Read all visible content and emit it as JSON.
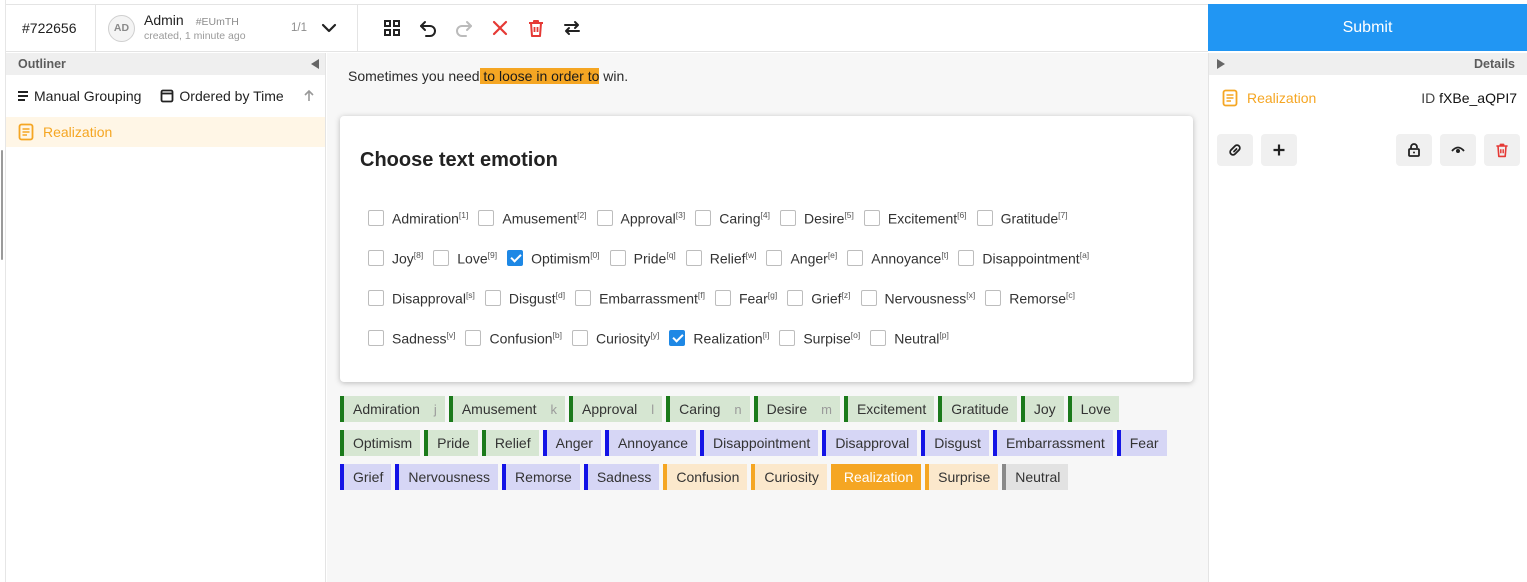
{
  "task": {
    "id": "#722656"
  },
  "annotation": {
    "avatar_initials": "AD",
    "user": "Admin",
    "tag": "#EUmTH",
    "meta": "created, 1 minute ago",
    "count": "1/1"
  },
  "toolbar": {
    "icons": [
      "grid-icon",
      "undo-icon",
      "redo-icon",
      "close-icon",
      "trash-icon",
      "swap-icon"
    ],
    "submit_label": "Submit"
  },
  "outliner": {
    "title": "Outliner",
    "grouping_label": "Manual Grouping",
    "ordering_label": "Ordered by Time",
    "regions": [
      {
        "label": "Realization"
      }
    ]
  },
  "text": {
    "before": "Sometimes you need",
    "highlight": " to loose in order to",
    "after": " win."
  },
  "choices": {
    "title": "Choose text emotion",
    "rows": [
      [
        {
          "label": "Admiration",
          "hotkey": "[1]",
          "checked": false
        },
        {
          "label": "Amusement",
          "hotkey": "[2]",
          "checked": false
        },
        {
          "label": "Approval",
          "hotkey": "[3]",
          "checked": false
        },
        {
          "label": "Caring",
          "hotkey": "[4]",
          "checked": false
        },
        {
          "label": "Desire",
          "hotkey": "[5]",
          "checked": false
        },
        {
          "label": "Excitement",
          "hotkey": "[6]",
          "checked": false
        },
        {
          "label": "Gratitude",
          "hotkey": "[7]",
          "checked": false
        }
      ],
      [
        {
          "label": "Joy",
          "hotkey": "[8]",
          "checked": false
        },
        {
          "label": "Love",
          "hotkey": "[9]",
          "checked": false
        },
        {
          "label": "Optimism",
          "hotkey": "[0]",
          "checked": true
        },
        {
          "label": "Pride",
          "hotkey": "[q]",
          "checked": false
        },
        {
          "label": "Relief",
          "hotkey": "[w]",
          "checked": false
        },
        {
          "label": "Anger",
          "hotkey": "[e]",
          "checked": false
        },
        {
          "label": "Annoyance",
          "hotkey": "[t]",
          "checked": false
        },
        {
          "label": "Disappointment",
          "hotkey": "[a]",
          "checked": false
        }
      ],
      [
        {
          "label": "Disapproval",
          "hotkey": "[s]",
          "checked": false
        },
        {
          "label": "Disgust",
          "hotkey": "[d]",
          "checked": false
        },
        {
          "label": "Embarrassment",
          "hotkey": "[f]",
          "checked": false
        },
        {
          "label": "Fear",
          "hotkey": "[g]",
          "checked": false
        },
        {
          "label": "Grief",
          "hotkey": "[z]",
          "checked": false
        },
        {
          "label": "Nervousness",
          "hotkey": "[x]",
          "checked": false
        },
        {
          "label": "Remorse",
          "hotkey": "[c]",
          "checked": false
        }
      ],
      [
        {
          "label": "Sadness",
          "hotkey": "[v]",
          "checked": false
        },
        {
          "label": "Confusion",
          "hotkey": "[b]",
          "checked": false
        },
        {
          "label": "Curiosity",
          "hotkey": "[y]",
          "checked": false
        },
        {
          "label": "Realization",
          "hotkey": "[i]",
          "checked": true
        },
        {
          "label": "Surpise",
          "hotkey": "[o]",
          "checked": false
        },
        {
          "label": "Neutral",
          "hotkey": "[p]",
          "checked": false
        }
      ]
    ]
  },
  "labels": [
    {
      "label": "Admiration",
      "hotkey": "j",
      "group": "pos"
    },
    {
      "label": "Amusement",
      "hotkey": "k",
      "group": "pos"
    },
    {
      "label": "Approval",
      "hotkey": "l",
      "group": "pos"
    },
    {
      "label": "Caring",
      "hotkey": "n",
      "group": "pos"
    },
    {
      "label": "Desire",
      "hotkey": "m",
      "group": "pos"
    },
    {
      "label": "Excitement",
      "hotkey": "",
      "group": "pos"
    },
    {
      "label": "Gratitude",
      "hotkey": "",
      "group": "pos"
    },
    {
      "label": "Joy",
      "hotkey": "",
      "group": "pos"
    },
    {
      "label": "Love",
      "hotkey": "",
      "group": "pos"
    },
    {
      "label": "Optimism",
      "hotkey": "",
      "group": "pos"
    },
    {
      "label": "Pride",
      "hotkey": "",
      "group": "pos"
    },
    {
      "label": "Relief",
      "hotkey": "",
      "group": "pos"
    },
    {
      "label": "Anger",
      "hotkey": "",
      "group": "neg"
    },
    {
      "label": "Annoyance",
      "hotkey": "",
      "group": "neg"
    },
    {
      "label": "Disappointment",
      "hotkey": "",
      "group": "neg"
    },
    {
      "label": "Disapproval",
      "hotkey": "",
      "group": "neg"
    },
    {
      "label": "Disgust",
      "hotkey": "",
      "group": "neg"
    },
    {
      "label": "Embarrassment",
      "hotkey": "",
      "group": "neg"
    },
    {
      "label": "Fear",
      "hotkey": "",
      "group": "neg"
    },
    {
      "label": "Grief",
      "hotkey": "",
      "group": "neg"
    },
    {
      "label": "Nervousness",
      "hotkey": "",
      "group": "neg"
    },
    {
      "label": "Remorse",
      "hotkey": "",
      "group": "neg"
    },
    {
      "label": "Sadness",
      "hotkey": "",
      "group": "neg"
    },
    {
      "label": "Confusion",
      "hotkey": "",
      "group": "amb"
    },
    {
      "label": "Curiosity",
      "hotkey": "",
      "group": "amb"
    },
    {
      "label": "Realization",
      "hotkey": "",
      "group": "amb",
      "selected": true
    },
    {
      "label": "Surprise",
      "hotkey": "",
      "group": "amb"
    },
    {
      "label": "Neutral",
      "hotkey": "",
      "group": "neu"
    }
  ],
  "details": {
    "title": "Details",
    "region_label": "Realization",
    "id_prefix": "ID",
    "id_value": "fXBe_aQPI7"
  },
  "colors": {
    "accent": "#2196f3",
    "region": "#f5a623",
    "checkbox": "#1e88e5",
    "delete": "#e53935"
  }
}
